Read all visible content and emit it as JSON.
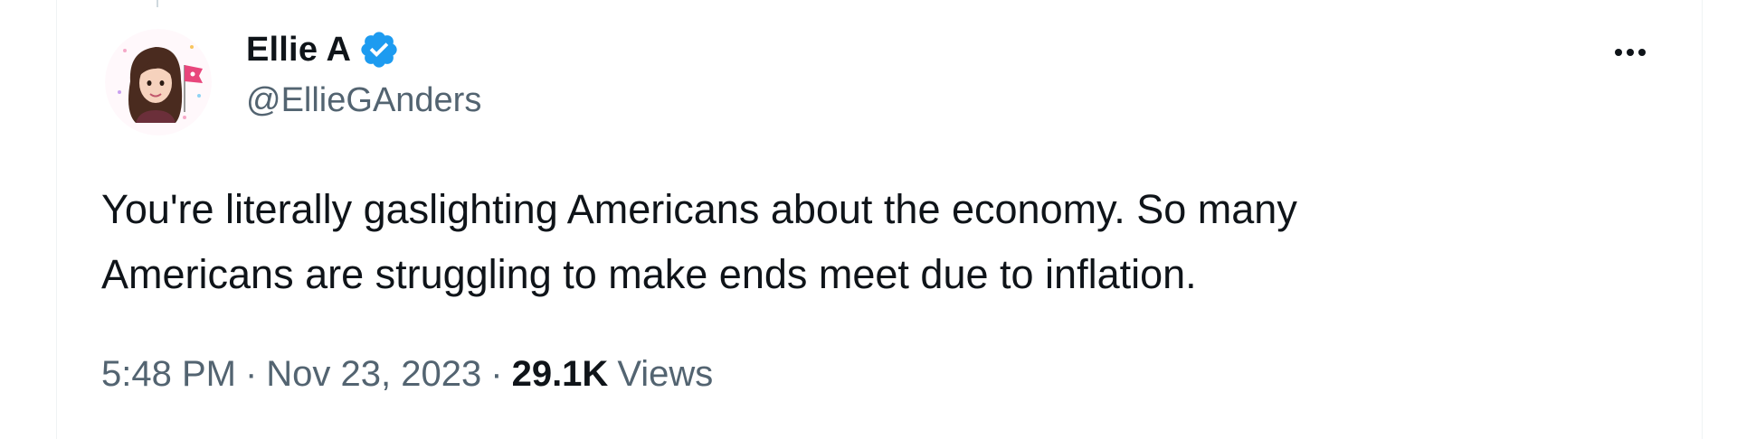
{
  "tweet": {
    "author": {
      "display_name": "Ellie A",
      "handle": "@EllieGAnders",
      "verified": true,
      "verified_color": "#1d9bf0"
    },
    "text_lines": [
      "You're literally gaslighting Americans about the economy. So many",
      "Americans are struggling to make ends meet due to inflation."
    ],
    "time": "5:48 PM",
    "separator": "·",
    "date": "Nov 23, 2023",
    "views_count": "29.1K",
    "views_label": "Views",
    "more_icon": "more-horizontal-icon"
  },
  "colors": {
    "text_primary": "#0f1419",
    "text_secondary": "#536471",
    "border": "#eff3f4"
  }
}
